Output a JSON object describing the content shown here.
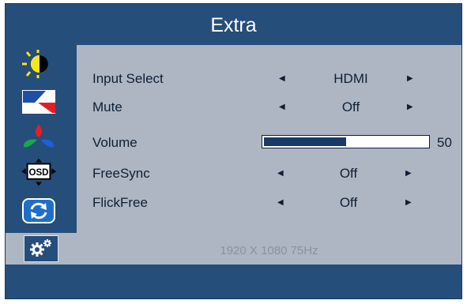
{
  "title": "Extra",
  "sidebar": {
    "items": [
      {
        "name": "luminance",
        "icon": "brightness-contrast-icon"
      },
      {
        "name": "image-setup",
        "icon": "image-setup-icon"
      },
      {
        "name": "color-setup",
        "icon": "color-setup-icon"
      },
      {
        "name": "osd-setup",
        "icon": "osd-icon",
        "icon_text": "OSD"
      },
      {
        "name": "reset",
        "icon": "reset-icon"
      },
      {
        "name": "extra",
        "icon": "gear-icon",
        "selected": true
      }
    ]
  },
  "menu": {
    "input_select": {
      "label": "Input Select",
      "value": "HDMI"
    },
    "mute": {
      "label": "Mute",
      "value": "Off"
    },
    "volume": {
      "label": "Volume",
      "value": "50",
      "level": 0.5
    },
    "freesync": {
      "label": "FreeSync",
      "value": "Off"
    },
    "flickfree": {
      "label": "FlickFree",
      "value": "Off"
    }
  },
  "status": "1920 X 1080 75Hz",
  "colors": {
    "frame": "#254e7a",
    "panel": "#aeb6c3",
    "text": "#0f1f35",
    "bar_fill": "#173a69"
  }
}
